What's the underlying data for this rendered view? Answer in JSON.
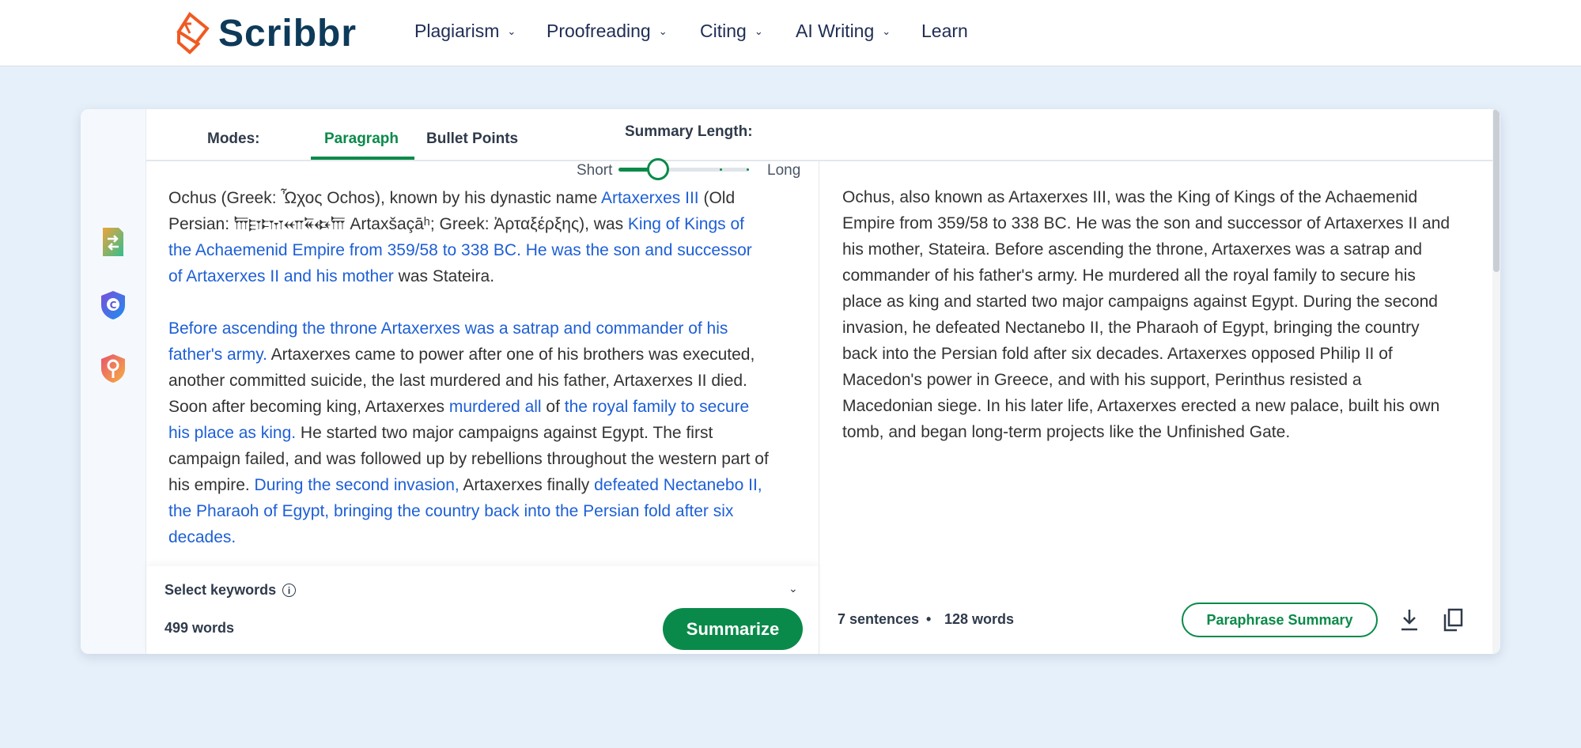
{
  "brand": {
    "name": "Scribbr",
    "logo_color": "#f05a22",
    "text_color": "#0e3a5a"
  },
  "nav": [
    {
      "label": "Plagiarism",
      "dropdown": true
    },
    {
      "label": "Proofreading",
      "dropdown": true
    },
    {
      "label": "Citing",
      "dropdown": true
    },
    {
      "label": "AI Writing",
      "dropdown": true
    },
    {
      "label": "Learn",
      "dropdown": false
    }
  ],
  "sidebar": {
    "icons": [
      "paraphraser-icon",
      "citation-checker-icon",
      "ai-detector-icon"
    ]
  },
  "toolbar": {
    "modes_label": "Modes:",
    "tabs": [
      "Paragraph",
      "Bullet Points"
    ],
    "active_tab": "Paragraph",
    "summary_length_label": "Summary Length:",
    "short_label": "Short",
    "long_label": "Long",
    "summary_length_value": 0.3
  },
  "input": {
    "paragraphs": [
      [
        {
          "t": "Ochus (Greek: Ὦχος Ochos), known by his dynastic name ",
          "h": false
        },
        {
          "t": "Artaxerxes III",
          "h": true
        },
        {
          "t": " (Old Persian: 𐎠𐎼𐎫𐎧𐏁𐏃𐎠 Artaxšaçāʰ; Greek: Ἀρταξέρξης), was ",
          "h": false
        },
        {
          "t": "King of Kings of the Achaemenid Empire from 359/58 to 338 BC. He was the son and successor of Artaxerxes II and his mother",
          "h": true
        },
        {
          "t": " was Stateira.",
          "h": false
        }
      ],
      [
        {
          "t": "Before ascending the throne Artaxerxes was a satrap and commander of his father's army.",
          "h": true
        },
        {
          "t": " Artaxerxes came to power after one of his brothers was executed, another committed suicide, the last murdered and his father, Artaxerxes II died. Soon after becoming king, Artaxerxes ",
          "h": false
        },
        {
          "t": "murdered all",
          "h": true
        },
        {
          "t": " of ",
          "h": false
        },
        {
          "t": "the royal family to secure his place as king.",
          "h": true
        },
        {
          "t": " He started two major campaigns against Egypt. The first campaign failed, and was followed up by rebellions throughout the western part of his empire. ",
          "h": false
        },
        {
          "t": "During the second invasion,",
          "h": true
        },
        {
          "t": " Artaxerxes finally ",
          "h": false
        },
        {
          "t": "defeated Nectanebo II, the Pharaoh of Egypt, bringing the country back into the Persian fold after six decades.",
          "h": true
        }
      ]
    ],
    "select_keywords_label": "Select keywords",
    "word_count": "499 words",
    "summarize_label": "Summarize"
  },
  "output": {
    "summary": "Ochus, also known as Artaxerxes III, was the King of Kings of the Achaemenid Empire from 359/58 to 338 BC. He was the son and successor of Artaxerxes II and his mother, Stateira. Before ascending the throne, Artaxerxes was a satrap and commander of his father's army. He murdered all the royal family to secure his place as king and started two major campaigns against Egypt. During the second invasion, he defeated Nectanebo II, the Pharaoh of Egypt, bringing the country back into the Persian fold after six decades. Artaxerxes opposed Philip II of Macedon's power in Greece, and with his support, Perinthus resisted a Macedonian siege. In his later life, Artaxerxes erected a new palace, built his own tomb, and began long-term projects like the Unfinished Gate.",
    "sentences": "7 sentences",
    "separator": "•",
    "words": "128 words",
    "paraphrase_label": "Paraphrase Summary"
  },
  "colors": {
    "accent": "#0a8a4a",
    "highlight": "#1d5fd6",
    "background": "#e6f0fa"
  }
}
